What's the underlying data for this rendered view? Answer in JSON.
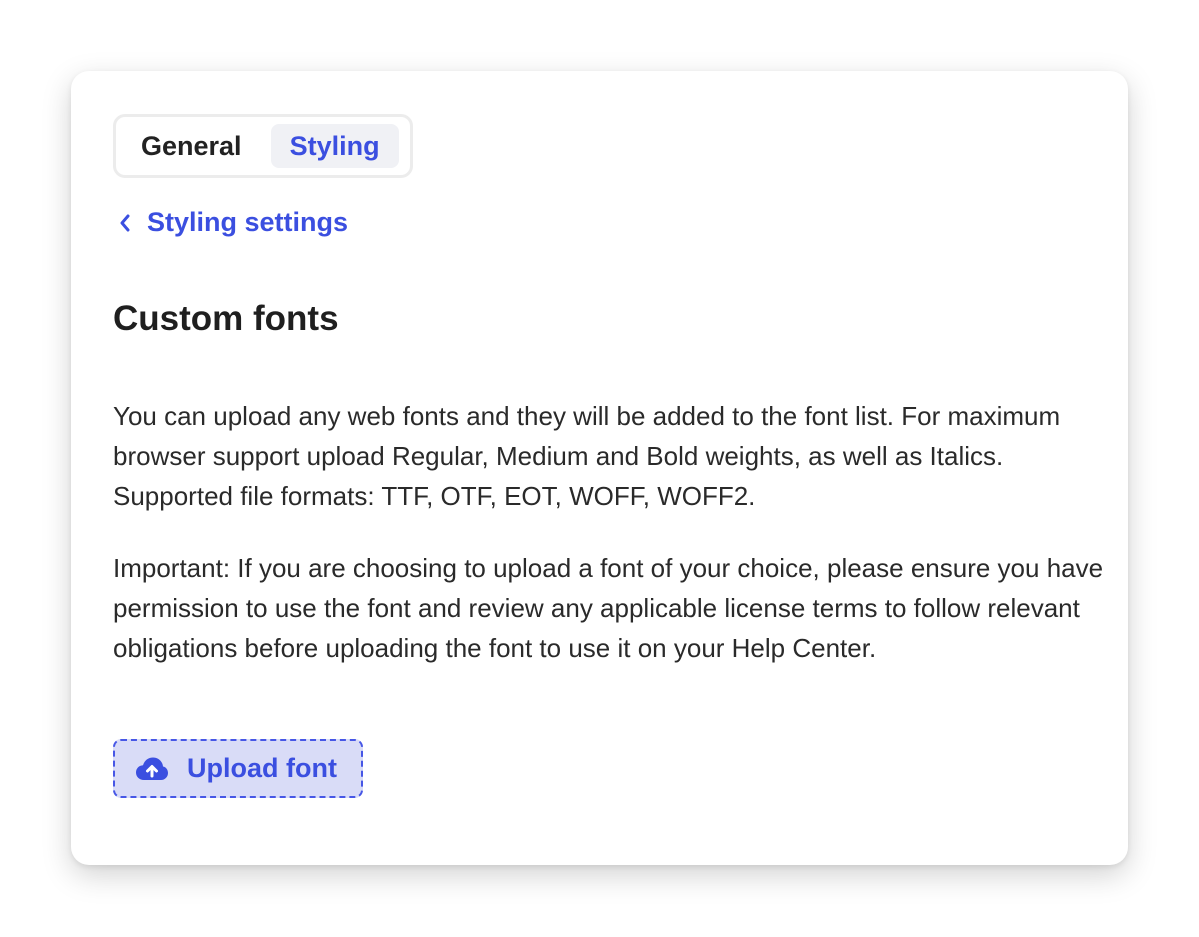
{
  "tabs": [
    {
      "label": "General",
      "active": false
    },
    {
      "label": "Styling",
      "active": true
    }
  ],
  "nav": {
    "back_label": "Styling settings",
    "back_icon": "chevron-left-icon"
  },
  "section": {
    "title": "Custom fonts",
    "description": "You can upload any web fonts and they will be added to the font list. For maximum browser support upload Regular, Medium and Bold weights, as well as Italics. Supported file formats: TTF, OTF, EOT, WOFF, WOFF2.",
    "notice": "Important: If you are choosing to upload a font of your choice, please ensure you have permission to use the font and review any applicable license terms to follow relevant obligations before uploading the font to use it on your Help Center."
  },
  "upload": {
    "label": "Upload font",
    "icon": "cloud-upload-icon"
  },
  "colors": {
    "accent": "#3b4fe0",
    "upload_bg": "#d9dcf7"
  }
}
